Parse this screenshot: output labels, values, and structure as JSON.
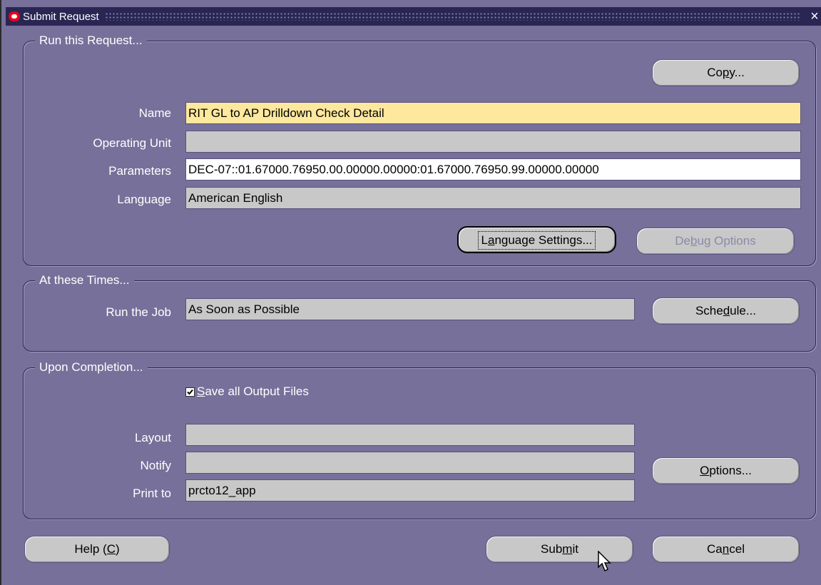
{
  "window": {
    "title": "Submit Request",
    "close_label": "×"
  },
  "run_section": {
    "legend": "Run this Request...",
    "copy_button": {
      "pre": "Co",
      "mn": "p",
      "post": "y..."
    },
    "name_label": "Name",
    "name_value": "RIT GL to AP Drilldown Check Detail",
    "operating_unit_label": "Operating Unit",
    "operating_unit_value": "",
    "parameters_label": "Parameters",
    "parameters_value": "DEC-07::01.67000.76950.00.00000.00000:01.67000.76950.99.00000.00000",
    "language_label": "Language",
    "language_value": "American English",
    "language_settings_button": {
      "pre": "L",
      "mn": "a",
      "post": "nguage Settings..."
    },
    "debug_options_button": {
      "pre": "De",
      "mn": "b",
      "post": "ug Options"
    }
  },
  "times_section": {
    "legend": "At these Times...",
    "run_job_label": "Run the Job",
    "run_job_value": "As Soon as Possible",
    "schedule_button": {
      "pre": "Sche",
      "mn": "d",
      "post": "ule..."
    }
  },
  "completion_section": {
    "legend": "Upon Completion...",
    "save_output": {
      "checked": true,
      "mn": "S",
      "post": "ave all Output Files"
    },
    "layout_label": "Layout",
    "layout_value": "",
    "notify_label": "Notify",
    "notify_value": "",
    "print_to_label": "Print to",
    "print_to_value": "prcto12_app",
    "options_button": {
      "pre": "",
      "mn": "O",
      "post": "ptions..."
    }
  },
  "footer": {
    "help_button": {
      "pre": "Help (",
      "mn": "C",
      "post": ")"
    },
    "submit_button": {
      "pre": "Sub",
      "mn": "m",
      "post": "it"
    },
    "cancel_button": {
      "pre": "Ca",
      "mn": "n",
      "post": "cel"
    }
  },
  "colors": {
    "background": "#77709a",
    "titlebar": "#2a2654",
    "required_field": "#fde89e",
    "field": "#c8c8c8",
    "button": "#c8c8c8"
  }
}
